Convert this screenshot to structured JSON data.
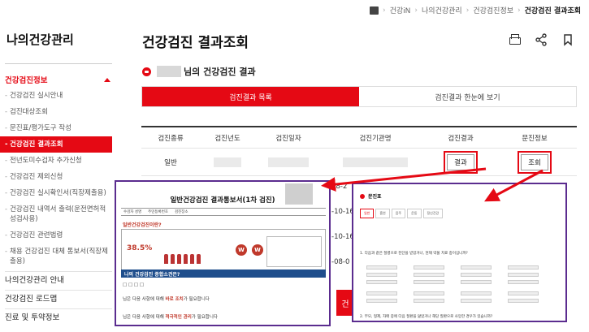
{
  "breadcrumb": {
    "items": [
      "건강iN",
      "나의건강관리",
      "건강검진정보"
    ],
    "current": "건강검진 결과조회"
  },
  "sidebar": {
    "title": "나의건강관리",
    "section": "건강검진정보",
    "items": [
      "건강검진 실시안내",
      "검진대상조회",
      "문진표/평가도구 작성",
      "건강검진 결과조회",
      "전년도미수검자 추가신청",
      "건강검진 제외신청",
      "건강검진 실시확인서(직장제출용)",
      "건강검진 내역서 출력(운전면허적성검사용)",
      "건강검진 관련법령",
      "채용 건강검진 대체 통보서(직장제출용)"
    ],
    "bottom": [
      "나의건강관리 안내",
      "건강검진 로드맵",
      "진료 및 투약정보"
    ]
  },
  "main": {
    "title": "건강검진 결과조회",
    "result_suffix": "님의 건강검진 결과",
    "tabs": [
      "검진결과 목록",
      "검진결과 한눈에 보기"
    ],
    "table": {
      "headers": [
        "검진종류",
        "검진년도",
        "검진일자",
        "검진기관명",
        "검진결과",
        "문진정보"
      ],
      "first_row_type": "일반",
      "result_button": "결과",
      "inquiry_button": "조회"
    },
    "date_fragments": [
      "-10-16",
      "-10-16",
      "-08-2",
      "-08-0"
    ],
    "bottom_button_fragment": "건"
  },
  "popup_left": {
    "title": "일반건강검진 결과통보서(1차 검진)",
    "info": [
      "수검자 성명",
      "주민등록번호",
      "검진장소"
    ],
    "question": "일반건강검진이란?",
    "stat": "38.5%",
    "letter": "W",
    "section": "나의 건강검진 종합소견은?",
    "line1": "님은 다음 사항에 대해 ",
    "line1_hi": "바로 조치",
    "line1_end": "가 필요합니다",
    "line2": "님은 다음 사항에 대해 ",
    "line2_hi": "적극적인 관리",
    "line2_end": "가 필요합니다"
  },
  "popup_right": {
    "title": "문진표",
    "tabs": [
      "일반",
      "흡연",
      "음주",
      "운동",
      "정신건강"
    ],
    "q1": "1. 다음과 같은 질병으로 진단을 받았거나, 현재 약물 치료 중이십니까?",
    "q2": "2. 부모, 형제, 자매 중에 다음 질환을 앓았거나 해당 질환으로 사망한 경우가 있습니까?"
  }
}
